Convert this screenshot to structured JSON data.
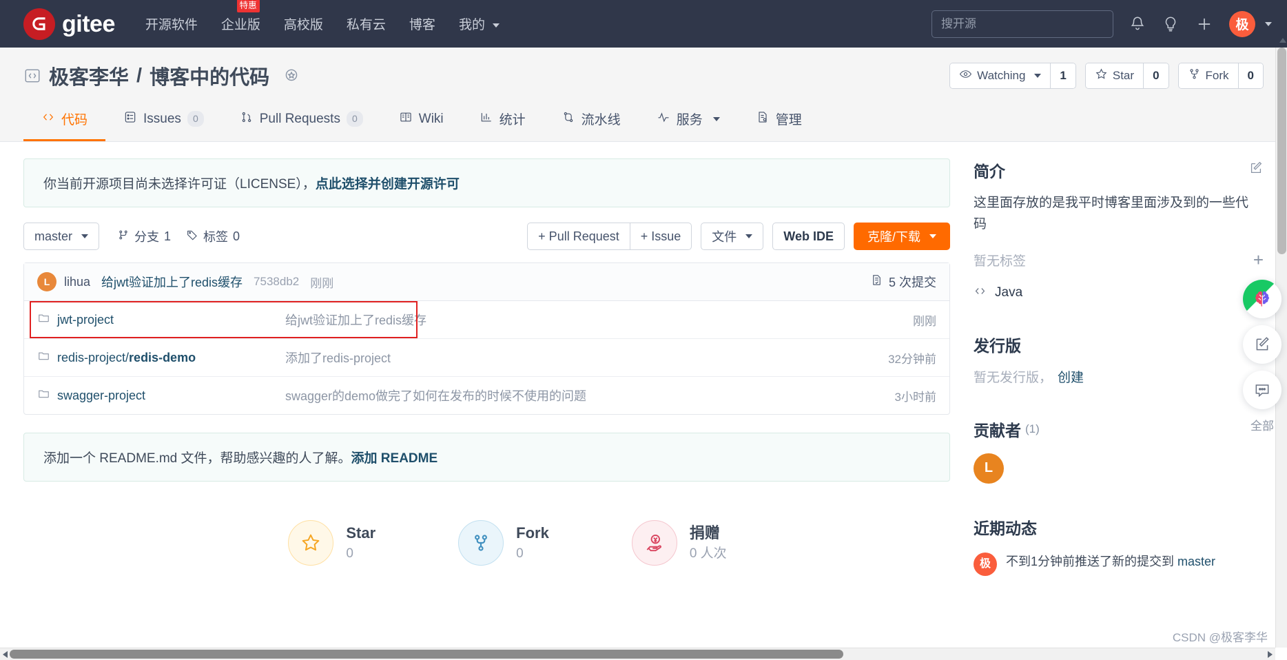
{
  "topnav": {
    "brand": "gitee",
    "links": [
      {
        "label": "开源软件",
        "badge": null,
        "caret": false
      },
      {
        "label": "企业版",
        "badge": "特惠",
        "caret": false
      },
      {
        "label": "高校版",
        "badge": null,
        "caret": false
      },
      {
        "label": "私有云",
        "badge": null,
        "caret": false
      },
      {
        "label": "博客",
        "badge": null,
        "caret": false
      },
      {
        "label": "我的",
        "badge": null,
        "caret": true
      }
    ],
    "search_placeholder": "搜开源",
    "icons": [
      "bell-icon",
      "lightbulb-icon",
      "plus-icon"
    ],
    "avatar_initial": "极"
  },
  "repo": {
    "owner": "极客李华",
    "separator": "/",
    "name": "博客中的代码",
    "actions": [
      {
        "name": "watching",
        "label": "Watching",
        "count": "1",
        "caret": true
      },
      {
        "name": "star",
        "label": "Star",
        "count": "0",
        "caret": false
      },
      {
        "name": "fork",
        "label": "Fork",
        "count": "0",
        "caret": false
      }
    ],
    "tabs": [
      {
        "key": "code",
        "label": "代码",
        "count": null,
        "active": true,
        "caret": false
      },
      {
        "key": "issues",
        "label": "Issues",
        "count": "0",
        "active": false,
        "caret": false
      },
      {
        "key": "pulls",
        "label": "Pull Requests",
        "count": "0",
        "active": false,
        "caret": false
      },
      {
        "key": "wiki",
        "label": "Wiki",
        "count": null,
        "active": false,
        "caret": false
      },
      {
        "key": "stats",
        "label": "统计",
        "count": null,
        "active": false,
        "caret": false
      },
      {
        "key": "pipeline",
        "label": "流水线",
        "count": null,
        "active": false,
        "caret": false
      },
      {
        "key": "services",
        "label": "服务",
        "count": null,
        "active": false,
        "caret": true
      },
      {
        "key": "manage",
        "label": "管理",
        "count": null,
        "active": false,
        "caret": false
      }
    ]
  },
  "license_notice": {
    "text": "你当前开源项目尚未选择许可证（LICENSE），",
    "link": "点此选择并创建开源许可"
  },
  "toolbar": {
    "branch": "master",
    "branches_label": "分支",
    "branches_count": "1",
    "tags_label": "标签",
    "tags_count": "0",
    "pull_request_label": "+ Pull Request",
    "issue_label": "+ Issue",
    "files_label": "文件",
    "web_ide_label": "Web IDE",
    "clone_label": "克隆/下载"
  },
  "commit_bar": {
    "avatar_initial": "L",
    "author": "lihua",
    "message": "给jwt验证加上了redis缓存",
    "sha": "7538db2",
    "time": "刚刚",
    "commits_label": "5 次提交"
  },
  "files": [
    {
      "name": "jwt-project",
      "name_bold": "",
      "message": "给jwt验证加上了redis缓存",
      "time": "刚刚",
      "highlighted": true
    },
    {
      "name": "redis-project/",
      "name_bold": "redis-demo",
      "message": "添加了redis-project",
      "time": "32分钟前",
      "highlighted": false
    },
    {
      "name": "swagger-project",
      "name_bold": "",
      "message": "swagger的demo做完了如何在发布的时候不使用的问题",
      "time": "3小时前",
      "highlighted": false
    }
  ],
  "readme_notice": {
    "text": "添加一个 README.md 文件，帮助感兴趣的人了解。",
    "link": "添加 README"
  },
  "stats": [
    {
      "key": "star",
      "label": "Star",
      "value": "0",
      "icon": "star-icon"
    },
    {
      "key": "fork",
      "label": "Fork",
      "value": "0",
      "icon": "fork-icon"
    },
    {
      "key": "donate",
      "label": "捐赠",
      "value": "0 人次",
      "icon": "donate-icon"
    }
  ],
  "sidebar": {
    "intro_title": "简介",
    "description": "这里面存放的是我平时博客里面涉及到的一些代码",
    "no_tags": "暂无标签",
    "language": "Java",
    "releases_title": "发行版",
    "releases_empty": "暂无发行版，",
    "releases_create": "创建",
    "contributors_title": "贡献者",
    "contributors_count": "(1)",
    "contributor_initial": "L",
    "activity_title": "近期动态",
    "activity": [
      {
        "avatar": "极",
        "text_prefix": "不到1分钟前推送了新的提交到 ",
        "branch": "master"
      }
    ]
  },
  "float_rail": {
    "ai_label": "ai-brain-icon",
    "edit_label": "edit-icon",
    "comment_label": "comment-icon",
    "all_label": "全部"
  },
  "watermark": "CSDN @极客李华",
  "colors": {
    "nav_bg": "#30374a",
    "accent": "#ff7300",
    "primary_btn": "#ff6a00",
    "link": "#1f4f6b",
    "logo_red": "#c71d23",
    "highlight": "#e02020"
  }
}
